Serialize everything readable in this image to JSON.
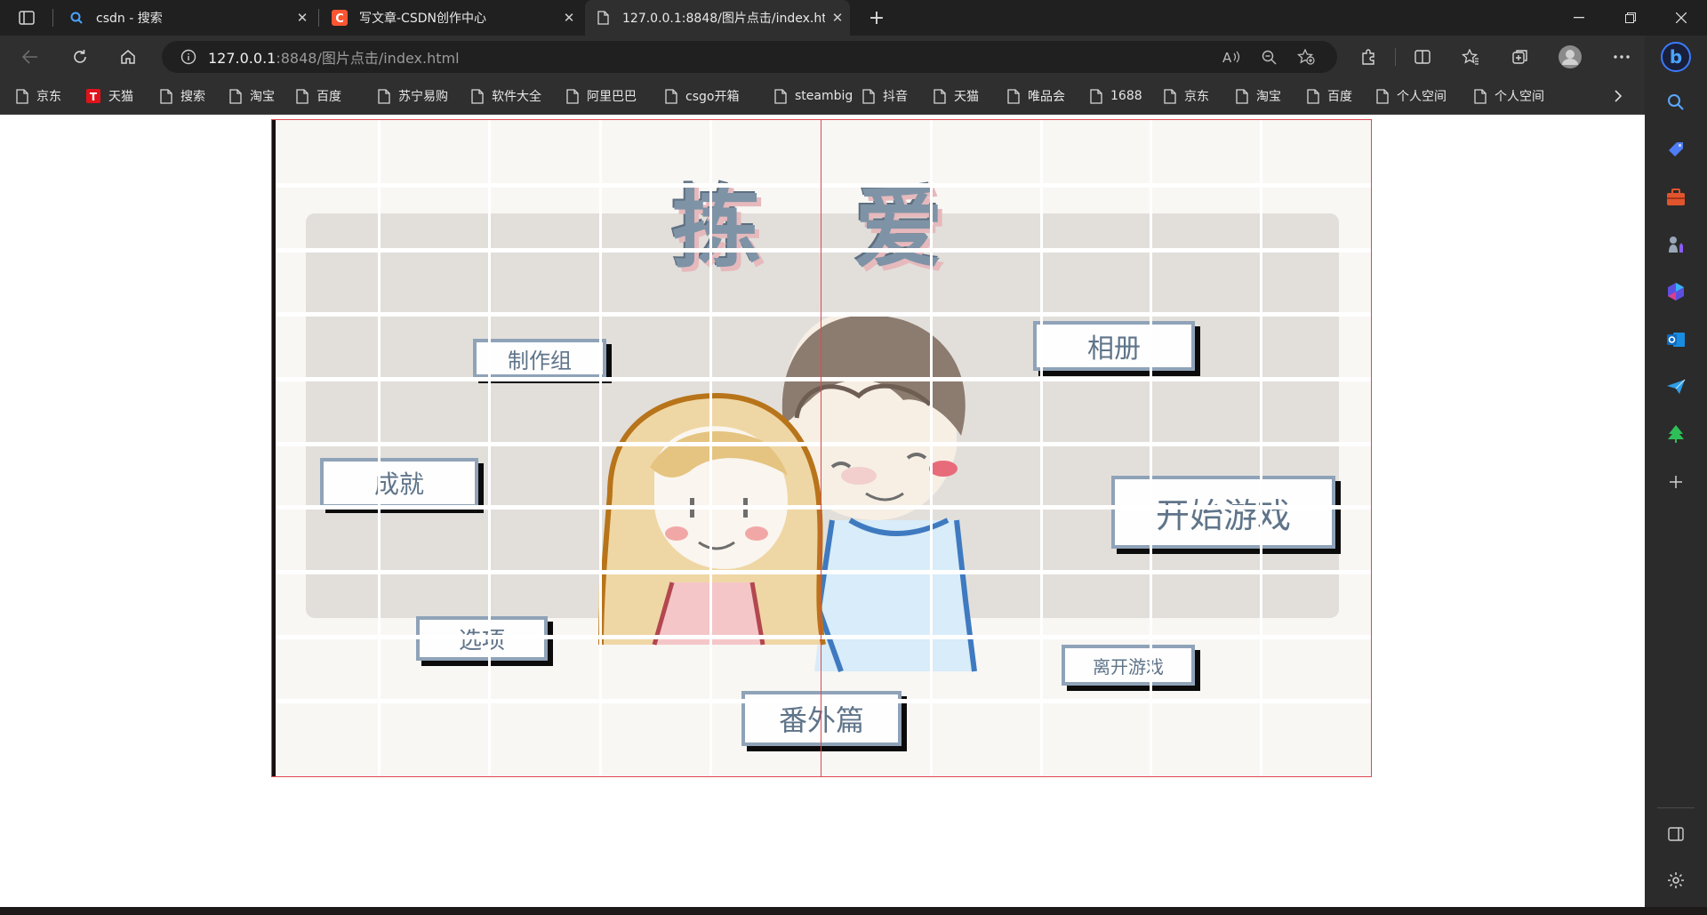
{
  "tabs": [
    {
      "title": "csdn - 搜索",
      "icon": "search-icon",
      "close": "✕"
    },
    {
      "title": "写文章-CSDN创作中心",
      "icon": "csdn-logo-icon",
      "close": "✕"
    },
    {
      "title": "127.0.0.1:8848/图片点击/index.ht",
      "icon": "page-icon",
      "close": "✕"
    }
  ],
  "toolbar": {
    "url_host": "127.0.0.1",
    "url_rest": ":8848/图片点击/index.html"
  },
  "bookmarks": [
    {
      "label": "京东",
      "icon": "page-icon"
    },
    {
      "label": "天猫",
      "icon": "tmall-logo-icon"
    },
    {
      "label": "搜索",
      "icon": "page-icon"
    },
    {
      "label": "淘宝",
      "icon": "page-icon"
    },
    {
      "label": "百度",
      "icon": "page-icon"
    },
    {
      "label": "苏宁易购",
      "icon": "page-icon"
    },
    {
      "label": "软件大全",
      "icon": "page-icon"
    },
    {
      "label": "阿里巴巴",
      "icon": "page-icon"
    },
    {
      "label": "csgo开箱",
      "icon": "page-icon"
    },
    {
      "label": "steambig",
      "icon": "page-icon"
    },
    {
      "label": "抖音",
      "icon": "page-icon"
    },
    {
      "label": "天猫",
      "icon": "page-icon"
    },
    {
      "label": "唯品会",
      "icon": "page-icon"
    },
    {
      "label": "1688",
      "icon": "page-icon"
    },
    {
      "label": "京东",
      "icon": "page-icon"
    },
    {
      "label": "淘宝",
      "icon": "page-icon"
    },
    {
      "label": "百度",
      "icon": "page-icon"
    },
    {
      "label": "个人空间",
      "icon": "page-icon"
    },
    {
      "label": "个人空间",
      "icon": "page-icon"
    }
  ],
  "game": {
    "title_left": "拣",
    "title_right": "爱",
    "buttons": {
      "staff": "制作组",
      "album": "相册",
      "achievements": "成就",
      "start": "开始游戏",
      "options": "选项",
      "quit": "离开游戏",
      "extra": "番外篇"
    }
  },
  "colors": {
    "accent_border": "#e0474f",
    "button_border": "#8fa3b8",
    "button_text": "#5f7489",
    "panel": "#e2dfdb"
  }
}
